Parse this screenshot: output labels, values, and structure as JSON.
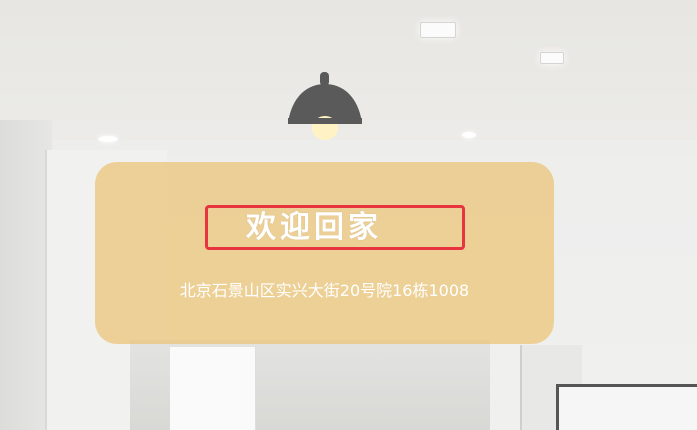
{
  "welcome": {
    "title": "欢迎回家",
    "address": "北京石景山区实兴大街20号院16栋1008"
  },
  "colors": {
    "card_background": "#ECC475",
    "highlight_border": "#E8343F",
    "text": "#FFFFFF",
    "lamp_shade": "#5A5A5A",
    "bulb": "#FFF3C4"
  },
  "icons": {
    "lamp": "pendant-lamp-icon"
  }
}
